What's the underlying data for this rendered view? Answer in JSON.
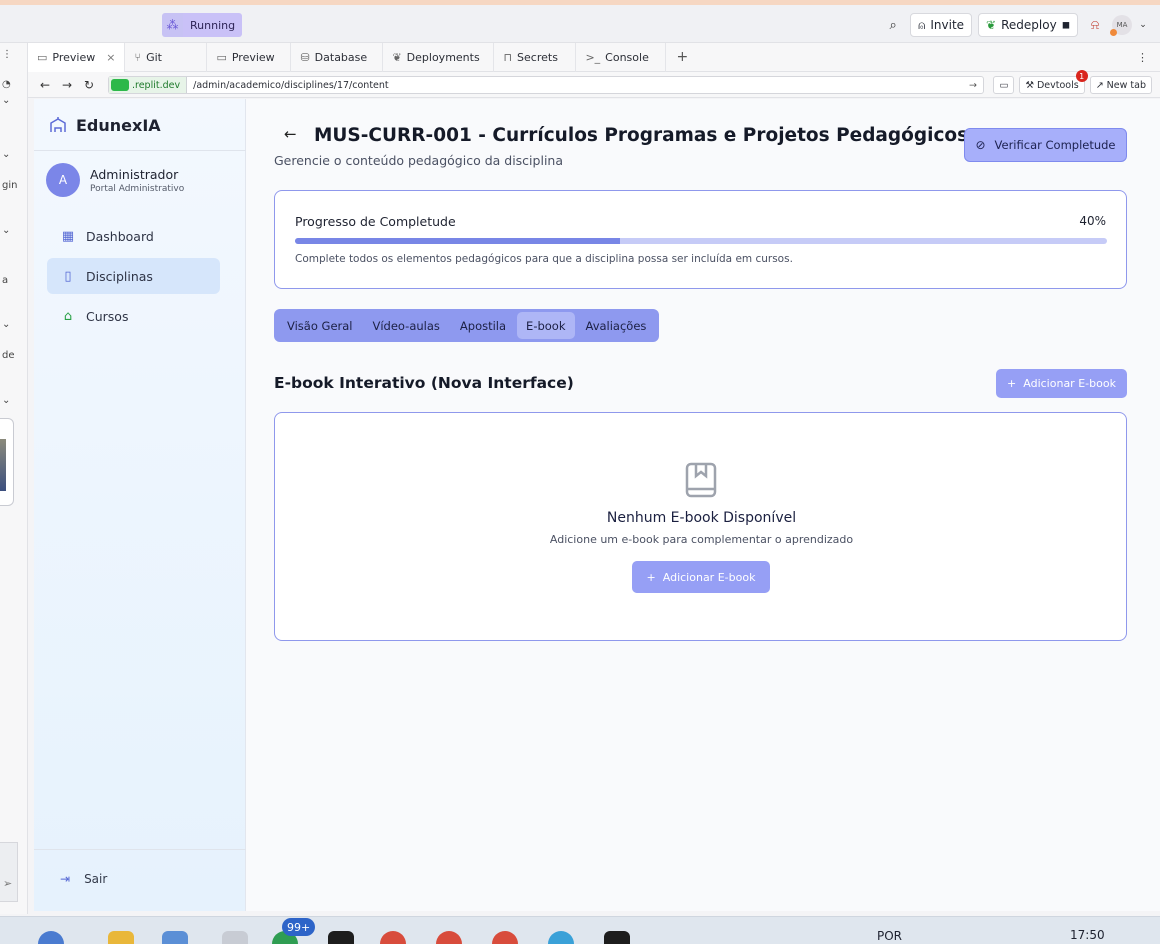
{
  "topbar": {
    "status": "Running",
    "invite": "Invite",
    "redeploy": "Redeploy",
    "avatar_initials": "MA"
  },
  "tabs": [
    {
      "label": "Preview",
      "icon": "monitor-icon"
    },
    {
      "label": "Git",
      "icon": "git-icon"
    },
    {
      "label": "Preview",
      "icon": "monitor-icon"
    },
    {
      "label": "Database",
      "icon": "database-icon"
    },
    {
      "label": "Deployments",
      "icon": "deploy-icon"
    },
    {
      "label": "Secrets",
      "icon": "lock-icon"
    },
    {
      "label": "Console",
      "icon": "terminal-icon"
    }
  ],
  "addressbar": {
    "host": ".replit.dev",
    "path": "/admin/academico/disciplines/17/content",
    "devtools": "Devtools",
    "devtools_badge": "1",
    "new_tab": "New tab"
  },
  "left_strip": [
    "gin",
    "a",
    "de"
  ],
  "sidebar": {
    "brand": "EdunexIA",
    "user_initial": "A",
    "user_name": "Administrador",
    "user_role": "Portal Administrativo",
    "items": [
      {
        "label": "Dashboard",
        "icon": "grid-icon"
      },
      {
        "label": "Disciplinas",
        "icon": "book-icon",
        "active": true
      },
      {
        "label": "Cursos",
        "icon": "school-icon"
      }
    ],
    "logout": "Sair"
  },
  "main": {
    "title": "MUS-CURR-001 - Currículos Programas e Projetos Pedagógicos",
    "subtitle": "Gerencie o conteúdo pedagógico da disciplina",
    "verify_button": "Verificar Completude",
    "progress": {
      "title": "Progresso de Completude",
      "percent_label": "40%",
      "value": 0.4,
      "description": "Complete todos os elementos pedagógicos para que a disciplina possa ser incluída em cursos."
    },
    "content_tabs": [
      {
        "label": "Visão Geral",
        "active": false
      },
      {
        "label": "Vídeo-aulas",
        "active": false
      },
      {
        "label": "Apostila",
        "active": false
      },
      {
        "label": "E-book",
        "active": true
      },
      {
        "label": "Avaliações",
        "active": false
      }
    ],
    "section_title": "E-book Interativo (Nova Interface)",
    "add_button": "Adicionar E-book",
    "empty": {
      "title": "Nenhum E-book Disponível",
      "subtitle": "Adicione um e-book para complementar o aprendizado",
      "button": "Adicionar E-book"
    }
  },
  "taskbar": {
    "badge": "99+",
    "lang": "POR",
    "time": "17:50"
  },
  "colors": {
    "accent": "#8e99ef",
    "progress_fill": "#7886e6",
    "card_border": "#8f98ec"
  }
}
